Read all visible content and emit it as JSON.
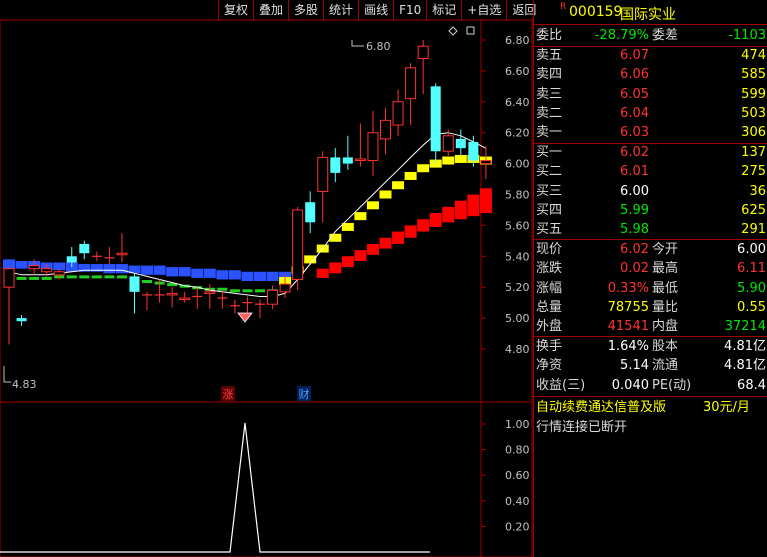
{
  "toolbar": [
    "复权",
    "叠加",
    "多股",
    "统计",
    "画线",
    "F10",
    "标记",
    "+自选",
    "返回"
  ],
  "stock": {
    "badge": "R",
    "code": "000159",
    "name": "国际实业"
  },
  "ratio": {
    "l1": "委比",
    "v1": "-28.79%",
    "l2": "委差",
    "v2": "-1103"
  },
  "asks": [
    {
      "label": "卖五",
      "price": "6.07",
      "vol": "474"
    },
    {
      "label": "卖四",
      "price": "6.06",
      "vol": "585"
    },
    {
      "label": "卖三",
      "price": "6.05",
      "vol": "599"
    },
    {
      "label": "卖二",
      "price": "6.04",
      "vol": "503"
    },
    {
      "label": "卖一",
      "price": "6.03",
      "vol": "306"
    }
  ],
  "bids": [
    {
      "label": "买一",
      "price": "6.02",
      "vol": "137"
    },
    {
      "label": "买二",
      "price": "6.01",
      "vol": "275"
    },
    {
      "label": "买三",
      "price": "6.00",
      "vol": "36"
    },
    {
      "label": "买四",
      "price": "5.99",
      "vol": "625"
    },
    {
      "label": "买五",
      "price": "5.98",
      "vol": "291"
    }
  ],
  "quote": [
    {
      "l1": "现价",
      "v1": "6.02",
      "l2": "今开",
      "v2": "6.00"
    },
    {
      "l1": "涨跌",
      "v1": "0.02",
      "l2": "最高",
      "v2": "6.11"
    },
    {
      "l1": "涨幅",
      "v1": "0.33%",
      "l2": "最低",
      "v2": "5.90"
    },
    {
      "l1": "总量",
      "v1": "78755",
      "l2": "量比",
      "v2": "0.55"
    },
    {
      "l1": "外盘",
      "v1": "41541",
      "l2": "内盘",
      "v2": "37214"
    }
  ],
  "stats": [
    {
      "l1": "换手",
      "v1": "1.64%",
      "l2": "股本",
      "v2": "4.81亿"
    },
    {
      "l1": "净资",
      "v1": "5.14",
      "l2": "流通",
      "v2": "4.81亿"
    },
    {
      "l1": "收益(三)",
      "v1": "0.040",
      "l2": "PE(动)",
      "v2": "68.4"
    }
  ],
  "ad": {
    "text": "自动续费通达信普及版",
    "price": "30元/月"
  },
  "status": "行情连接已断开",
  "axis": {
    "price_ticks": [
      "6.80",
      "6.60",
      "6.40",
      "6.20",
      "6.00",
      "5.80",
      "5.60",
      "5.40",
      "5.20",
      "5.00",
      "4.80"
    ],
    "ind_ticks": [
      "1.00",
      "0.80",
      "0.60",
      "0.40",
      "0.20"
    ],
    "high_label": "6.80",
    "low_label": "4.83",
    "markers": [
      "涨",
      "财"
    ]
  },
  "colors": {
    "up": "#ff3232",
    "down": "#54ffff",
    "grid": "#a00000",
    "text": "#c0c0c0"
  },
  "chart_data": {
    "type": "candlestick",
    "ylim": [
      4.75,
      6.92
    ],
    "candles": [
      {
        "o": 5.2,
        "c": 5.32,
        "h": 5.33,
        "l": 4.83
      },
      {
        "o": 5.0,
        "c": 4.98,
        "h": 5.02,
        "l": 4.95
      },
      {
        "o": 5.32,
        "c": 5.34,
        "h": 5.38,
        "l": 5.28
      },
      {
        "o": 5.3,
        "c": 5.32,
        "h": 5.35,
        "l": 5.27
      },
      {
        "o": 5.28,
        "c": 5.3,
        "h": 5.32,
        "l": 5.25
      },
      {
        "o": 5.4,
        "c": 5.36,
        "h": 5.46,
        "l": 5.33
      },
      {
        "o": 5.48,
        "c": 5.42,
        "h": 5.5,
        "l": 5.38
      },
      {
        "o": 5.4,
        "c": 5.4,
        "h": 5.43,
        "l": 5.37
      },
      {
        "o": 5.39,
        "c": 5.39,
        "h": 5.46,
        "l": 5.35
      },
      {
        "o": 5.41,
        "c": 5.42,
        "h": 5.55,
        "l": 5.36
      },
      {
        "o": 5.27,
        "c": 5.17,
        "h": 5.29,
        "l": 5.03
      },
      {
        "o": 5.15,
        "c": 5.15,
        "h": 5.17,
        "l": 5.05
      },
      {
        "o": 5.15,
        "c": 5.15,
        "h": 5.25,
        "l": 5.1
      },
      {
        "o": 5.15,
        "c": 5.16,
        "h": 5.2,
        "l": 5.07
      },
      {
        "o": 5.12,
        "c": 5.13,
        "h": 5.17,
        "l": 5.1
      },
      {
        "o": 5.14,
        "c": 5.14,
        "h": 5.2,
        "l": 5.06
      },
      {
        "o": 5.16,
        "c": 5.17,
        "h": 5.22,
        "l": 5.06
      },
      {
        "o": 5.13,
        "c": 5.13,
        "h": 5.18,
        "l": 5.06
      },
      {
        "o": 5.08,
        "c": 5.08,
        "h": 5.12,
        "l": 5.03
      },
      {
        "o": 5.1,
        "c": 5.1,
        "h": 5.14,
        "l": 5.02
      },
      {
        "o": 5.09,
        "c": 5.09,
        "h": 5.12,
        "l": 5.0
      },
      {
        "o": 5.09,
        "c": 5.18,
        "h": 5.21,
        "l": 5.06
      },
      {
        "o": 5.17,
        "c": 5.22,
        "h": 5.28,
        "l": 5.13
      },
      {
        "o": 5.25,
        "c": 5.7,
        "h": 5.72,
        "l": 5.18
      },
      {
        "o": 5.75,
        "c": 5.62,
        "h": 5.82,
        "l": 5.55
      },
      {
        "o": 5.82,
        "c": 6.04,
        "h": 6.08,
        "l": 5.62
      },
      {
        "o": 6.04,
        "c": 5.94,
        "h": 6.1,
        "l": 5.88
      },
      {
        "o": 6.04,
        "c": 6.0,
        "h": 6.18,
        "l": 5.96
      },
      {
        "o": 6.02,
        "c": 6.03,
        "h": 6.26,
        "l": 5.98
      },
      {
        "o": 6.02,
        "c": 6.2,
        "h": 6.34,
        "l": 5.92
      },
      {
        "o": 6.16,
        "c": 6.28,
        "h": 6.36,
        "l": 6.06
      },
      {
        "o": 6.25,
        "c": 6.4,
        "h": 6.48,
        "l": 6.18
      },
      {
        "o": 6.42,
        "c": 6.62,
        "h": 6.65,
        "l": 6.25
      },
      {
        "o": 6.68,
        "c": 6.76,
        "h": 6.8,
        "l": 6.45
      },
      {
        "o": 6.5,
        "c": 6.08,
        "h": 6.52,
        "l": 6.0
      },
      {
        "o": 6.08,
        "c": 6.18,
        "h": 6.22,
        "l": 6.05
      },
      {
        "o": 6.16,
        "c": 6.1,
        "h": 6.22,
        "l": 6.05
      },
      {
        "o": 6.14,
        "c": 6.02,
        "h": 6.18,
        "l": 5.98
      },
      {
        "o": 6.0,
        "c": 6.02,
        "h": 6.11,
        "l": 5.9
      }
    ],
    "ma_white": [
      5.3,
      5.28,
      5.28,
      5.28,
      5.29,
      5.3,
      5.31,
      5.31,
      5.31,
      5.31,
      5.29,
      5.27,
      5.25,
      5.23,
      5.21,
      5.2,
      5.18,
      5.17,
      5.16,
      5.15,
      5.14,
      5.14,
      5.16,
      5.25,
      5.35,
      5.45,
      5.56,
      5.64,
      5.72,
      5.8,
      5.88,
      5.96,
      6.04,
      6.12,
      6.19,
      6.2,
      6.18,
      6.14,
      6.1
    ],
    "band_yellow": [
      null,
      null,
      null,
      null,
      null,
      null,
      null,
      null,
      null,
      null,
      null,
      null,
      null,
      null,
      null,
      null,
      null,
      null,
      null,
      null,
      null,
      null,
      5.24,
      5.31,
      5.38,
      5.45,
      5.52,
      5.59,
      5.66,
      5.73,
      5.8,
      5.86,
      5.92,
      5.97,
      6.0,
      6.02,
      6.03,
      6.03,
      6.02
    ],
    "band_red": [
      null,
      null,
      null,
      null,
      null,
      null,
      null,
      null,
      null,
      null,
      null,
      null,
      null,
      null,
      null,
      null,
      null,
      null,
      null,
      null,
      null,
      null,
      null,
      null,
      null,
      5.32,
      5.36,
      5.4,
      5.44,
      5.48,
      5.52,
      5.56,
      5.6,
      5.64,
      5.68,
      5.72,
      5.76,
      5.8,
      5.84
    ],
    "band_red_low": [
      null,
      null,
      null,
      null,
      null,
      null,
      null,
      null,
      null,
      null,
      null,
      null,
      null,
      null,
      null,
      null,
      null,
      null,
      null,
      null,
      null,
      null,
      null,
      null,
      null,
      5.26,
      5.29,
      5.33,
      5.37,
      5.41,
      5.45,
      5.48,
      5.52,
      5.56,
      5.59,
      5.62,
      5.64,
      5.66,
      5.68
    ],
    "blue_band": [
      [
        5.32,
        5.38
      ],
      [
        5.32,
        5.37
      ],
      [
        5.32,
        5.37
      ],
      [
        5.31,
        5.36
      ],
      [
        5.31,
        5.36
      ],
      [
        5.3,
        5.36
      ],
      [
        5.3,
        5.35
      ],
      [
        5.3,
        5.35
      ],
      [
        5.29,
        5.35
      ],
      [
        5.29,
        5.35
      ],
      [
        5.29,
        5.34
      ],
      [
        5.28,
        5.34
      ],
      [
        5.28,
        5.34
      ],
      [
        5.27,
        5.33
      ],
      [
        5.27,
        5.33
      ],
      [
        5.26,
        5.32
      ],
      [
        5.26,
        5.32
      ],
      [
        5.25,
        5.31
      ],
      [
        5.25,
        5.31
      ],
      [
        5.24,
        5.3
      ],
      [
        5.24,
        5.3
      ],
      [
        5.24,
        5.3
      ],
      [
        5.24,
        5.3
      ]
    ],
    "green_band": [
      5.27,
      5.26,
      5.26,
      5.26,
      5.27,
      5.27,
      5.27,
      5.27,
      5.27,
      5.27,
      5.25,
      5.24,
      5.23,
      5.22,
      5.21,
      5.2,
      5.19,
      5.19,
      5.18,
      5.18,
      5.18,
      5.18,
      5.2
    ],
    "indicator": {
      "ylim": [
        0,
        1.08
      ],
      "values": [
        0,
        0,
        0,
        0,
        0,
        0,
        0,
        0,
        0,
        0,
        0,
        0,
        0,
        0,
        0,
        0,
        0,
        0,
        0,
        0,
        0,
        0,
        0,
        0,
        0,
        0,
        0,
        0,
        0,
        0,
        1,
        0,
        0,
        0,
        0,
        0,
        0,
        0,
        0,
        0
      ]
    }
  }
}
